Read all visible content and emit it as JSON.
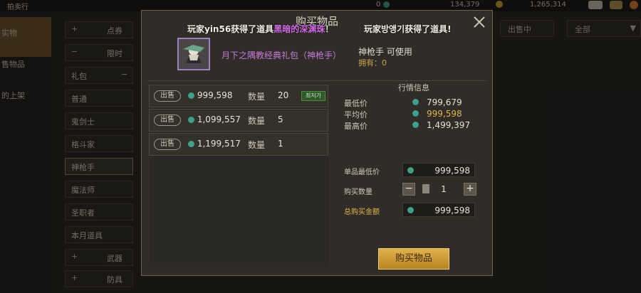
{
  "top_bar": {
    "left_label": "拍卖行",
    "coin_value": "0",
    "currency_value": "134,379",
    "gold_value": "1,265,314"
  },
  "left_nav": {
    "items": [
      "实物",
      "售物品",
      "的上架"
    ]
  },
  "categories": [
    {
      "symbol": "+",
      "label": "点券"
    },
    {
      "symbol": "−",
      "label": "限时"
    },
    {
      "symbol": "",
      "label": "礼包",
      "trail": "−"
    },
    {
      "symbol": "",
      "label": "普通"
    },
    {
      "symbol": "",
      "label": "鬼剑士"
    },
    {
      "symbol": "",
      "label": "格斗家"
    },
    {
      "symbol": "",
      "label": "神枪手"
    },
    {
      "symbol": "",
      "label": "魔法师"
    },
    {
      "symbol": "",
      "label": "圣职者"
    },
    {
      "symbol": "",
      "label": "本月道具"
    },
    {
      "symbol": "+",
      "label": "武器"
    },
    {
      "symbol": "+",
      "label": "防具"
    }
  ],
  "right_tabs": {
    "on_sale": "出售中",
    "filter": "全部"
  },
  "modal": {
    "title": "购买物品",
    "banner_left_prefix": "玩家yin56获得了道具",
    "banner_left_item": "黑暗的深渊珠",
    "banner_left_suffix": "！",
    "banner_right": "玩家방앵기获得了道具!",
    "item_name": "月下之隅教经典礼包（神枪手）",
    "usable_text": "神枪手 可使用",
    "owned_text": "拥有：0",
    "listings": [
      {
        "sell": "出售",
        "price": "999,598",
        "qty_label": "数量",
        "qty": "20",
        "badge": "최저가"
      },
      {
        "sell": "出售",
        "price": "1,099,557",
        "qty_label": "数量",
        "qty": "5",
        "badge": ""
      },
      {
        "sell": "出售",
        "price": "1,199,517",
        "qty_label": "数量",
        "qty": "1",
        "badge": ""
      }
    ],
    "market": {
      "title": "行情信息",
      "rows": [
        {
          "label": "最低价",
          "value": "799,679"
        },
        {
          "label": "平均价",
          "value": "999,598"
        },
        {
          "label": "最高价",
          "value": "1,499,397"
        }
      ]
    },
    "buy": {
      "unit_min_label": "单品最低价",
      "unit_min_value": "999,598",
      "qty_label": "购买数量",
      "qty_value": "1",
      "total_label": "总购买金额",
      "total_value": "999,598",
      "buy_button": "购买物品"
    }
  },
  "colors": {
    "accent_gold": "#e2b54c",
    "item_purple": "#c67bdc",
    "coin_teal": "#3fa08b"
  }
}
